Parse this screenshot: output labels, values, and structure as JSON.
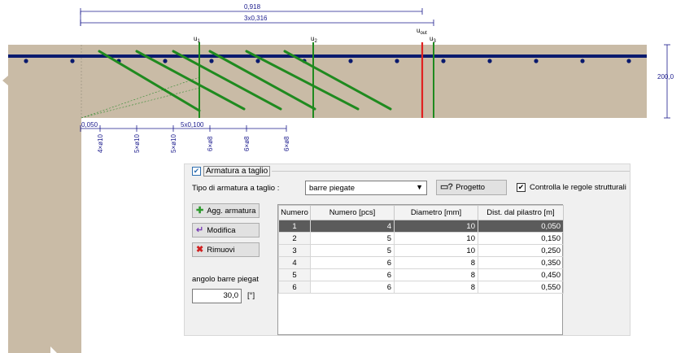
{
  "drawing": {
    "dim_total": "0,918",
    "dim_spacing": "3x0,316",
    "dim_first": "0,050",
    "dim_steps": "5x0,100",
    "height": "200,0",
    "u_labels": [
      {
        "base": "u",
        "sub": "1"
      },
      {
        "base": "u",
        "sub": "2"
      },
      {
        "base": "u",
        "sub": "3"
      }
    ],
    "u_out": {
      "base": "u",
      "sub": "out"
    },
    "bar_labels": [
      "4×ø10",
      "5×ø10",
      "5×ø10",
      "6×ø8",
      "6×ø8",
      "6×ø8"
    ],
    "colors": {
      "slab": "#c9bba6",
      "rebar": "#0a1a6e",
      "bent_bars": "#1f8a1f",
      "control_sections": "#1f8a1f",
      "outer_section": "#e02020",
      "dimension": "#1a1a8c"
    }
  },
  "panel": {
    "group_title": "Armatura a taglio",
    "group_checked": true,
    "type_label": "Tipo di armatura a taglio :",
    "type_value": "barre piegate",
    "project_button": "Progetto",
    "check_rules_label": "Controlla le regole strutturali",
    "check_rules_checked": true,
    "add_button": "Agg. armatura",
    "edit_button": "Modifica",
    "remove_button": "Rimuovi",
    "angle_label": "angolo barre piegat",
    "angle_value": "30,0",
    "angle_unit": "[°]",
    "table": {
      "headers": [
        "Numero",
        "Numero [pcs]",
        "Diametro [mm]",
        "Dist. dal pilastro [m]"
      ],
      "selected_row": 0,
      "rows": [
        {
          "n": "1",
          "pcs": "4",
          "dia": "10",
          "dist": "0,050"
        },
        {
          "n": "2",
          "pcs": "5",
          "dia": "10",
          "dist": "0,150"
        },
        {
          "n": "3",
          "pcs": "5",
          "dia": "10",
          "dist": "0,250"
        },
        {
          "n": "4",
          "pcs": "6",
          "dia": "8",
          "dist": "0,350"
        },
        {
          "n": "5",
          "pcs": "6",
          "dia": "8",
          "dist": "0,450"
        },
        {
          "n": "6",
          "pcs": "6",
          "dia": "8",
          "dist": "0,550"
        }
      ]
    }
  }
}
